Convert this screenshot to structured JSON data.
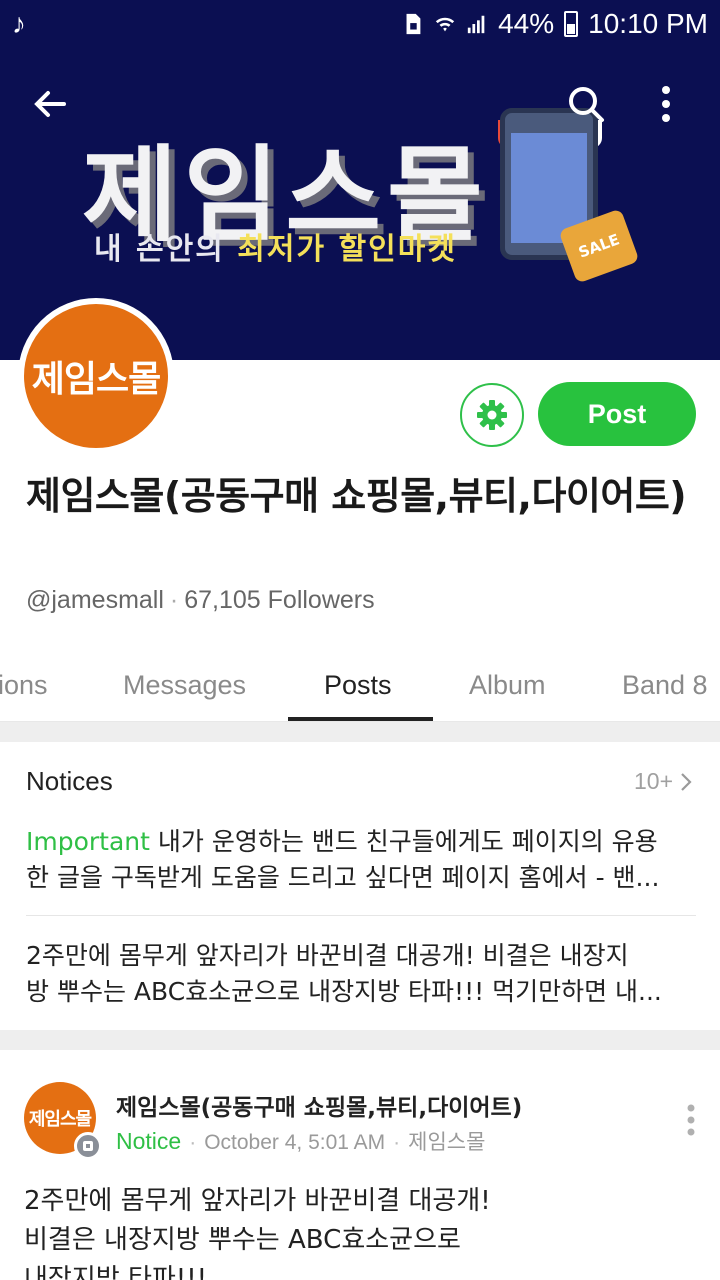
{
  "status_bar": {
    "battery": "44%",
    "time": "10:10 PM"
  },
  "banner": {
    "title": "제임스몰",
    "subtitle_pre": "내 손안의 ",
    "subtitle_hl": "최저가 할인마켓",
    "tag_label": "SALE",
    "tag_percent": "%"
  },
  "profile": {
    "avatar_text": "제임스몰",
    "post_button": "Post",
    "name": "제임스몰(공동구매 쇼핑몰,뷰티,다이어트)",
    "handle": "@jamesmall",
    "followers": "67,105 Followers"
  },
  "tabs": [
    {
      "label": "ions"
    },
    {
      "label": "Messages"
    },
    {
      "label": "Posts",
      "active": true
    },
    {
      "label": "Album"
    },
    {
      "label": "Band 8"
    }
  ],
  "notices": {
    "title": "Notices",
    "count": "10+",
    "items": [
      {
        "tag": "Important",
        "line1": " 내가 운영하는 밴드 친구들에게도 페이지의 유용",
        "line2": "한 글을 구독받게 도움을 드리고 싶다면 페이지 홈에서 - 밴..."
      },
      {
        "line1": "2주만에 몸무게 앞자리가 바꾼비결 대공개! 비결은 내장지",
        "line2": "방 뿌수는 ABC효소균으로 내장지방 타파!!! 먹기만하면 내..."
      }
    ]
  },
  "post": {
    "avatar_text": "제임스몰",
    "author": "제임스몰(공동구매 쇼핑몰,뷰티,다이어트)",
    "tag": "Notice",
    "date": "October 4, 5:01 AM",
    "source": "제임스몰",
    "body_lines": [
      "2주만에 몸무게 앞자리가 바꾼비결 대공개!",
      "비결은 내장지방 뿌수는 ABC효소균으로",
      "내장지방 타파!!!"
    ]
  },
  "colors": {
    "banner_bg": "#0b0f52",
    "accent_green": "#28c23e",
    "avatar_orange": "#e46f12"
  }
}
